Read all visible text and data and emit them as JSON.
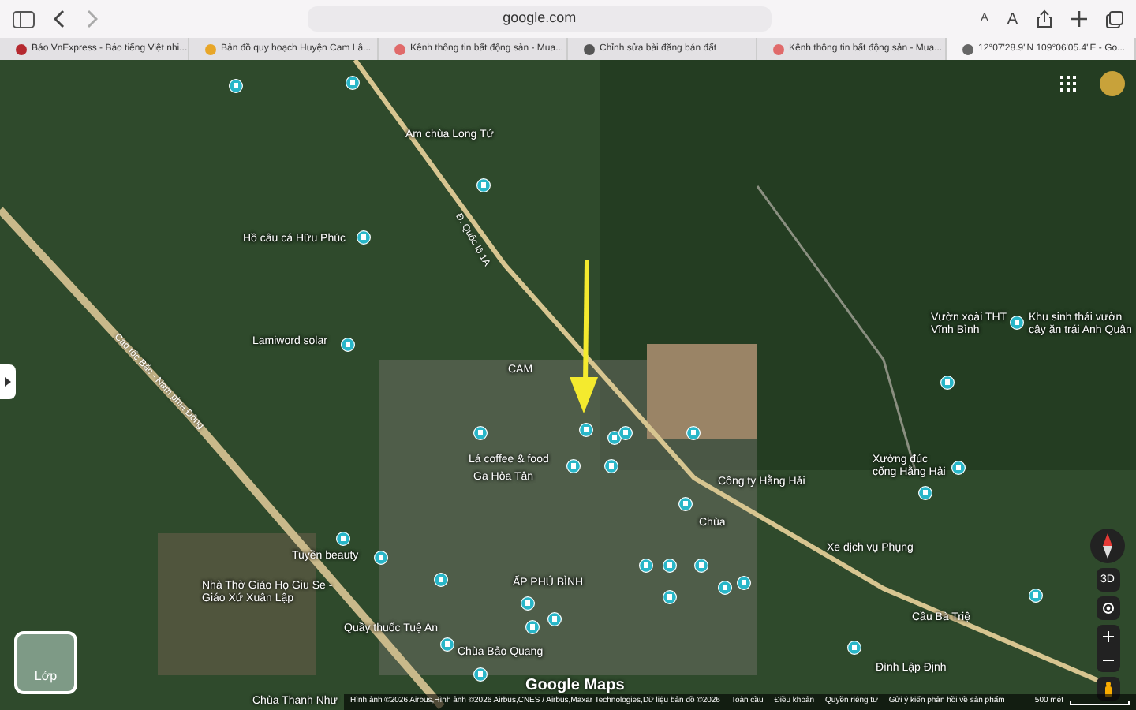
{
  "toolbar": {
    "address": "google.com",
    "text_size_buttons": [
      "A",
      "A"
    ]
  },
  "tabs": [
    {
      "label": "Báo VnExpress - Báo tiếng Việt nhi...",
      "selected": false
    },
    {
      "label": "Bản đồ quy hoạch Huyện Cam Lâ...",
      "selected": false
    },
    {
      "label": "Kênh thông tin bất động sản - Mua...",
      "selected": false
    },
    {
      "label": "Chỉnh sửa bài đăng bán đất",
      "selected": false
    },
    {
      "label": "Kênh thông tin bất động sản - Mua...",
      "selected": false
    },
    {
      "label": "12°07'28.9\"N 109°06'05.4\"E - Go...",
      "selected": true
    }
  ],
  "map": {
    "places": [
      {
        "label": "Am chùa Long Tứ"
      },
      {
        "label": "Hồ câu cá Hữu Phúc"
      },
      {
        "label": "Lamiword solar"
      },
      {
        "label": "Lá coffee & food"
      },
      {
        "label": "Ga Hòa Tân"
      },
      {
        "label": "Công ty Hằng Hải"
      },
      {
        "label": "Xưởng đúc cống Hằng Hải"
      },
      {
        "label": "Chùa"
      },
      {
        "label": "Xe dịch vụ Phụng"
      },
      {
        "label": "Tuyền beauty"
      },
      {
        "label": "Nhà Thờ Giáo Họ Giu Se - Giáo Xứ Xuân Lập"
      },
      {
        "label": "ẤP PHÚ BÌNH"
      },
      {
        "label": "Quầy thuốc Tuệ An"
      },
      {
        "label": "Chùa Bảo Quang"
      },
      {
        "label": "Cầu Bà Triệ"
      },
      {
        "label": "Đình Lập Định"
      },
      {
        "label": "Vườn xoài THT Vĩnh Bình"
      },
      {
        "label": "Khu sinh thái vườn cây ăn trái Anh Quân"
      },
      {
        "label": "CAM"
      },
      {
        "label": "Chùa Thanh Như"
      }
    ],
    "roads": [
      "Đ. Quốc lộ 1A",
      "Cao tốc Bắc - Nam phía Đông"
    ],
    "layers_button": "Lớp",
    "three_d_button": "3D",
    "logo": "Google Maps",
    "footer": [
      "Hình ảnh ©2026 Airbus,Hình ảnh ©2026 Airbus,CNES / Airbus,Maxar Technologies,Dữ liệu bản đồ ©2026",
      "Toàn cầu",
      "Điều khoản",
      "Quyền riêng tư",
      "Gửi ý kiến phản hồi về sản phẩm"
    ],
    "scale": "500 mét"
  }
}
